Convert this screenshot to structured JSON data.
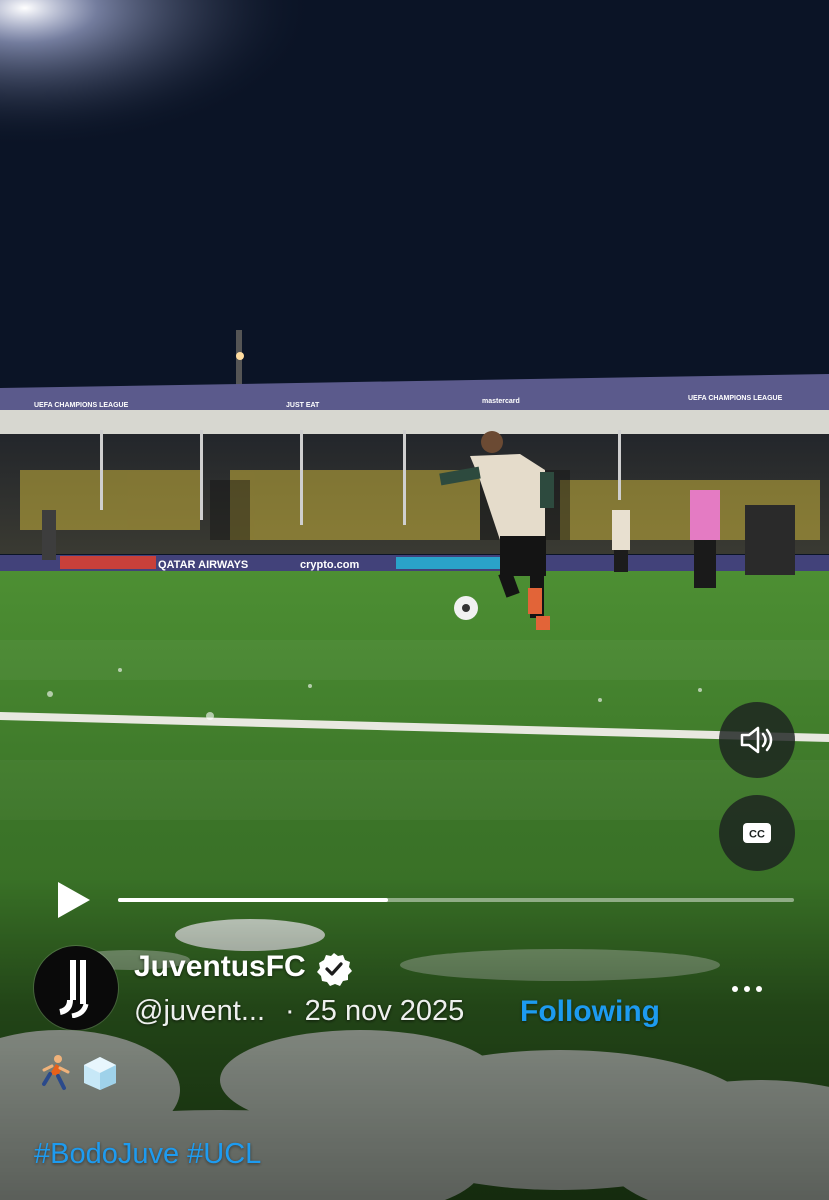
{
  "video": {
    "progress_fraction": 0.4,
    "mute_icon": "speaker-icon",
    "cc_label": "CC",
    "play_icon": "play-icon"
  },
  "stadium_signage": {
    "banner_left": "UEFA CHAMPIONS LEAGUE",
    "banner_mid1": "JUST EAT",
    "banner_mid2": "mastercard",
    "banner_right": "UEFA CHAMPIONS LEAGUE",
    "board1": "QATAR AIRWAYS",
    "board2": "crypto.com"
  },
  "post": {
    "display_name": "JuventusFC",
    "verified_icon": "verified-badge-icon",
    "handle": "@juvent...",
    "separator": "·",
    "date": "25 nov 2025",
    "follow_status": "Following",
    "more_icon": "more-icon",
    "emojis": [
      "person-running-icon",
      "ice-cube-icon"
    ],
    "hashtags": [
      "#BodoJuve",
      "#UCL"
    ]
  },
  "colors": {
    "link_blue": "#1d9bf0",
    "pitch_green": "#3f7a2a",
    "night_sky": "#0b1426"
  }
}
